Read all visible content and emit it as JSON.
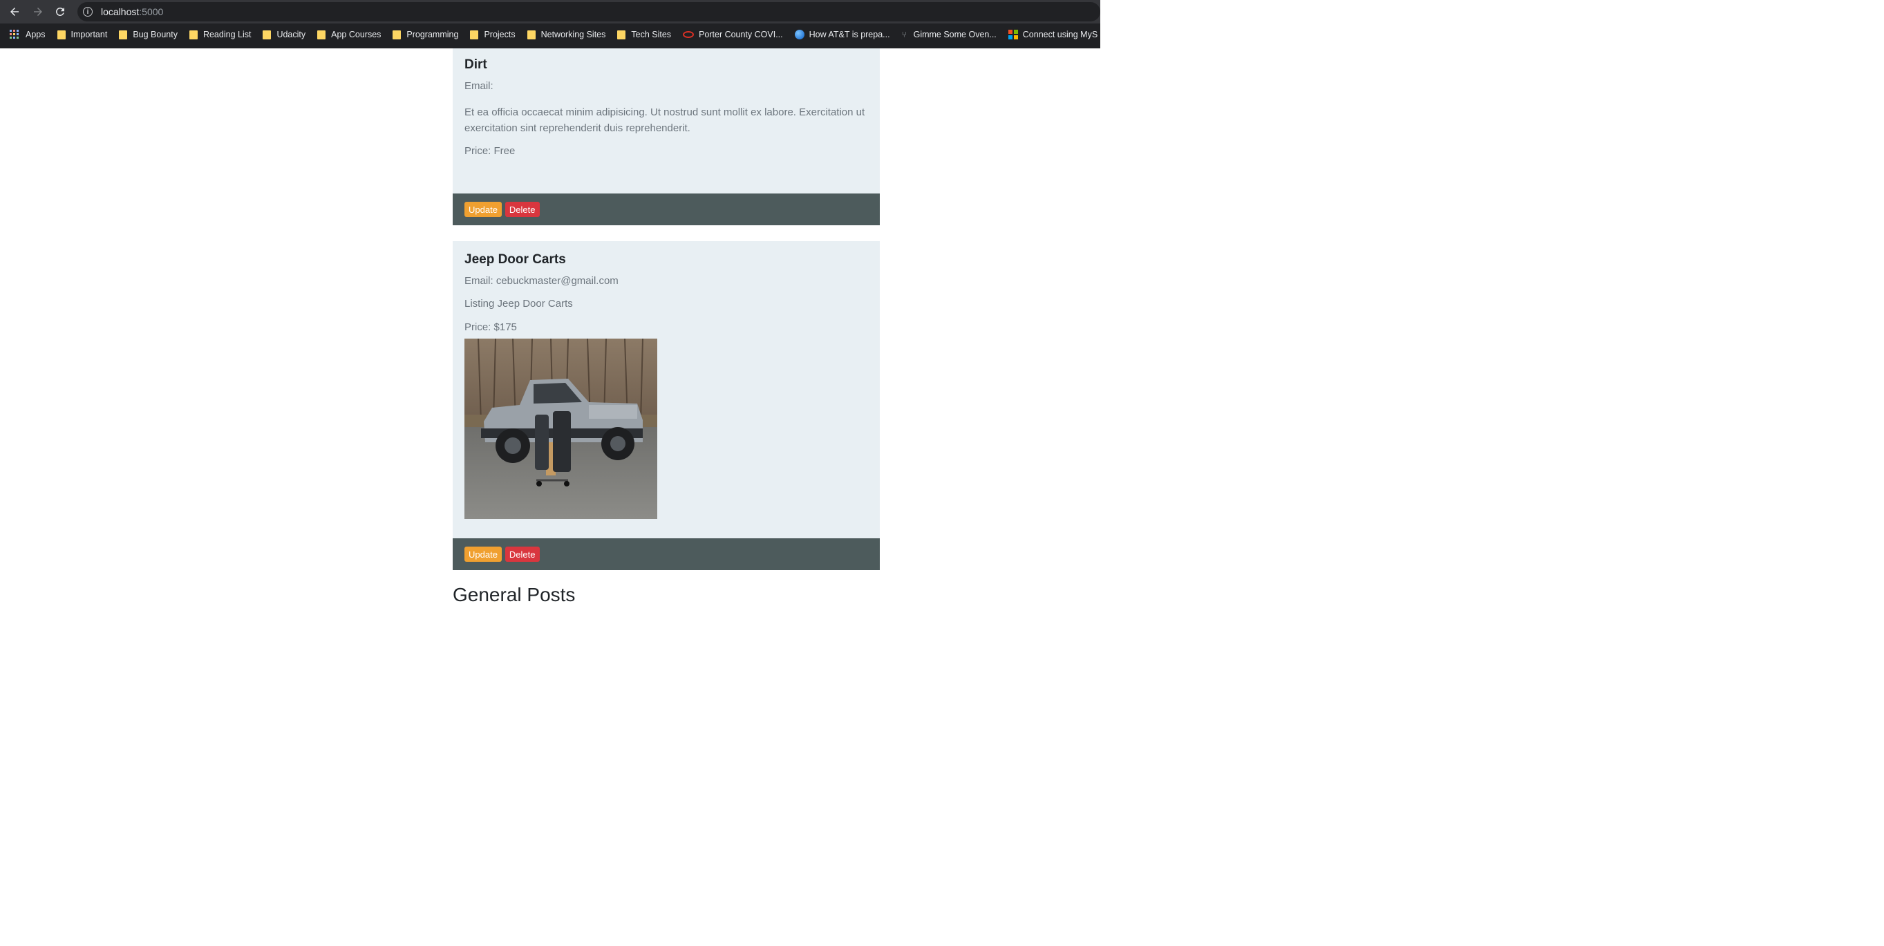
{
  "browser": {
    "url_host": "localhost",
    "url_port": ":5000",
    "bookmarks": [
      {
        "label": "Apps",
        "icon": "apps-grid-icon"
      },
      {
        "label": "Important",
        "icon": "folder-icon"
      },
      {
        "label": "Bug Bounty",
        "icon": "folder-icon"
      },
      {
        "label": "Reading List",
        "icon": "folder-icon"
      },
      {
        "label": "Udacity",
        "icon": "folder-icon"
      },
      {
        "label": "App Courses",
        "icon": "folder-icon"
      },
      {
        "label": "Programming",
        "icon": "folder-icon"
      },
      {
        "label": "Projects",
        "icon": "folder-icon"
      },
      {
        "label": "Networking Sites",
        "icon": "folder-icon"
      },
      {
        "label": "Tech Sites",
        "icon": "folder-icon"
      },
      {
        "label": "Porter County COVI...",
        "icon": "porter-county-icon"
      },
      {
        "label": "How AT&T is prepa...",
        "icon": "globe-icon"
      },
      {
        "label": "Gimme Some Oven...",
        "icon": "fork-icon"
      },
      {
        "label": "Connect using MyS",
        "icon": "microsoft-icon"
      }
    ]
  },
  "posts": [
    {
      "title": "Dirt",
      "email": "Email:",
      "description": "Et ea officia occaecat minim adipisicing. Ut nostrud sunt mollit ex labore. Exercitation ut exercitation sint reprehenderit duis reprehenderit.",
      "price": "Price: Free",
      "update_label": "Update",
      "delete_label": "Delete"
    },
    {
      "title": "Jeep Door Carts",
      "email": "Email: cebuckmaster@gmail.com",
      "description": "Listing Jeep Door Carts",
      "price": "Price: $175",
      "update_label": "Update",
      "delete_label": "Delete"
    }
  ],
  "general_posts_heading": "General Posts",
  "colors": {
    "card_bg": "#e8eff3",
    "footer_bg": "#4d5b5c",
    "update_btn": "#f0a030",
    "delete_btn": "#d9363e"
  }
}
